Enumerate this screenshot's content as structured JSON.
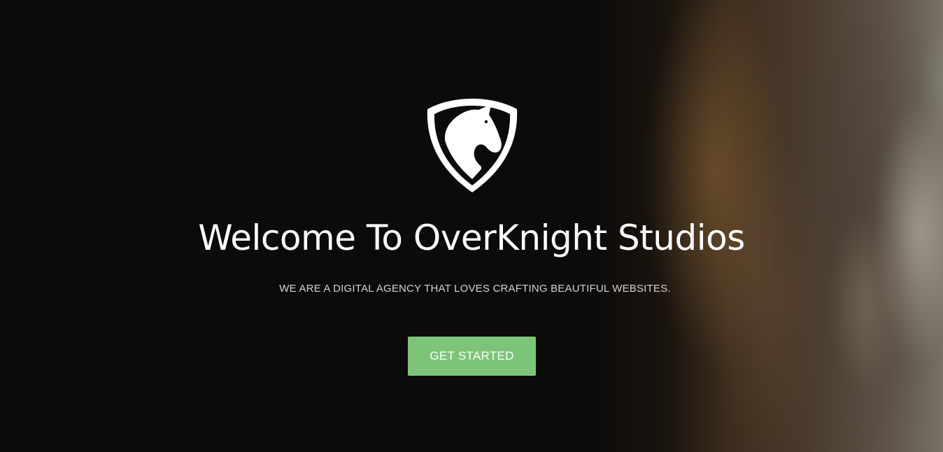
{
  "hero": {
    "logo_icon": "knight-shield-icon",
    "title": "Welcome To OverKnight Studios",
    "tagline": "WE ARE A DIGITAL AGENCY THAT LOVES CRAFTING BEAUTIFUL WEBSITES.",
    "cta_label": "GET STARTED"
  },
  "colors": {
    "background": "#0c0b09",
    "text": "#ffffff",
    "tagline": "#d6d3cf",
    "cta": "#7cc478"
  }
}
